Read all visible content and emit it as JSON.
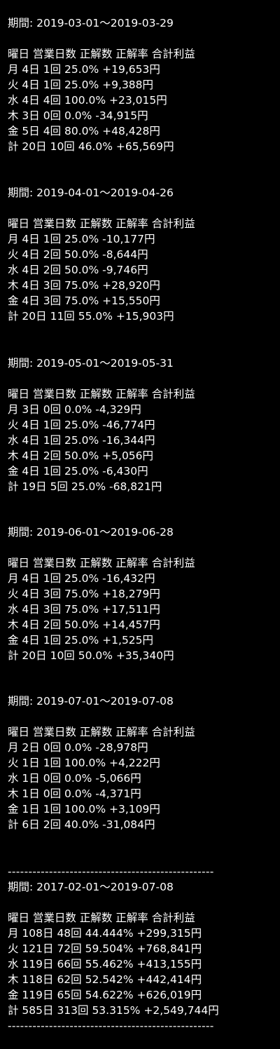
{
  "header_labels": "曜日 営業日数 正解数 正解率 合計利益",
  "separator": "--------------------------------------------------",
  "sections": [
    {
      "period": "期間: 2019-03-01～2019-03-29",
      "rows": [
        "月 4日 1回 25.0% +19,653円",
        "火 4日 1回 25.0% +9,388円",
        "水 4日 4回 100.0% +23,015円",
        "木 3日 0回 0.0% -34,915円",
        "金 5日 4回 80.0% +48,428円",
        "計 20日 10回 46.0% +65,569円"
      ]
    },
    {
      "period": "期間: 2019-04-01～2019-04-26",
      "rows": [
        "月 4日 1回 25.0% -10,177円",
        "火 4日 2回 50.0% -8,644円",
        "水 4日 2回 50.0% -9,746円",
        "木 4日 3回 75.0% +28,920円",
        "金 4日 3回 75.0% +15,550円",
        "計 20日 11回 55.0% +15,903円"
      ]
    },
    {
      "period": "期間: 2019-05-01～2019-05-31",
      "rows": [
        "月 3日 0回 0.0% -4,329円",
        "火 4日 1回 25.0% -46,774円",
        "水 4日 1回 25.0% -16,344円",
        "木 4日 2回 50.0% +5,056円",
        "金 4日 1回 25.0% -6,430円",
        "計 19日 5回 25.0% -68,821円"
      ]
    },
    {
      "period": "期間: 2019-06-01～2019-06-28",
      "rows": [
        "月 4日 1回 25.0% -16,432円",
        "火 4日 3回 75.0% +18,279円",
        "水 4日 3回 75.0% +17,511円",
        "木 4日 2回 50.0% +14,457円",
        "金 4日 1回 25.0% +1,525円",
        "計 20日 10回 50.0% +35,340円"
      ]
    },
    {
      "period": "期間: 2019-07-01～2019-07-08",
      "rows": [
        "月 2日 0回 0.0% -28,978円",
        "火 1日 1回 100.0% +4,222円",
        "水 1日 0回 0.0% -5,066円",
        "木 1日 0回 0.0% -4,371円",
        "金 1日 1回 100.0% +3,109円",
        "計 6日 2回 40.0% -31,084円"
      ]
    }
  ],
  "summary": {
    "period": "期間: 2017-02-01～2019-07-08",
    "rows": [
      "月 108日 48回 44.444% +299,315円",
      "火 121日 72回 59.504% +768,841円",
      "水 119日 66回 55.462% +413,155円",
      "木 118日 62回 52.542% +442,414円",
      "金 119日 65回 54.622% +626,019円",
      "計 585日 313回 53.315% +2,549,744円"
    ]
  }
}
